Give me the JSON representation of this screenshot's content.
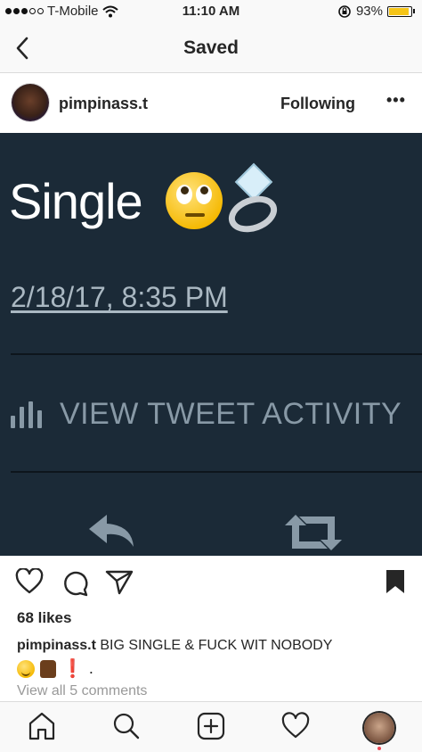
{
  "status_bar": {
    "carrier": "T-Mobile",
    "time": "11:10 AM",
    "battery_percent": "93%",
    "battery_level": 0.93,
    "signal_bars_filled": 3,
    "signal_bars_total": 5
  },
  "nav": {
    "back_icon": "chevron-left-icon",
    "title": "Saved"
  },
  "post": {
    "username": "pimpinass.t",
    "follow_state": "Following",
    "more_label": "•••",
    "tweet": {
      "text": "Single",
      "emojis": [
        "rolling-eyes-emoji",
        "ring-emoji"
      ],
      "timestamp": "2/18/17, 8:35 PM",
      "activity_label": "VIEW TWEET ACTIVITY",
      "icons": [
        "reply-icon",
        "retweet-icon"
      ]
    },
    "likes": "68 likes",
    "caption_username": "pimpinass.t",
    "caption_text": "BIG SINGLE & FUCK WIT NOBODY",
    "caption_tail": ".",
    "caption_emojis": [
      "relieved-face-emoji",
      "thumbs-up-emoji",
      "exclamation-emoji"
    ],
    "exclamation": "❗",
    "view_comments": "View all 5 comments"
  },
  "tabbar": {
    "items": [
      "home-icon",
      "search-icon",
      "add-post-icon",
      "activity-heart-icon",
      "profile-avatar"
    ]
  },
  "colors": {
    "tweet_background": "#1b2a37",
    "tweet_muted": "#8899a6",
    "battery_fill": "#f5c518",
    "notification": "#ed4956"
  }
}
